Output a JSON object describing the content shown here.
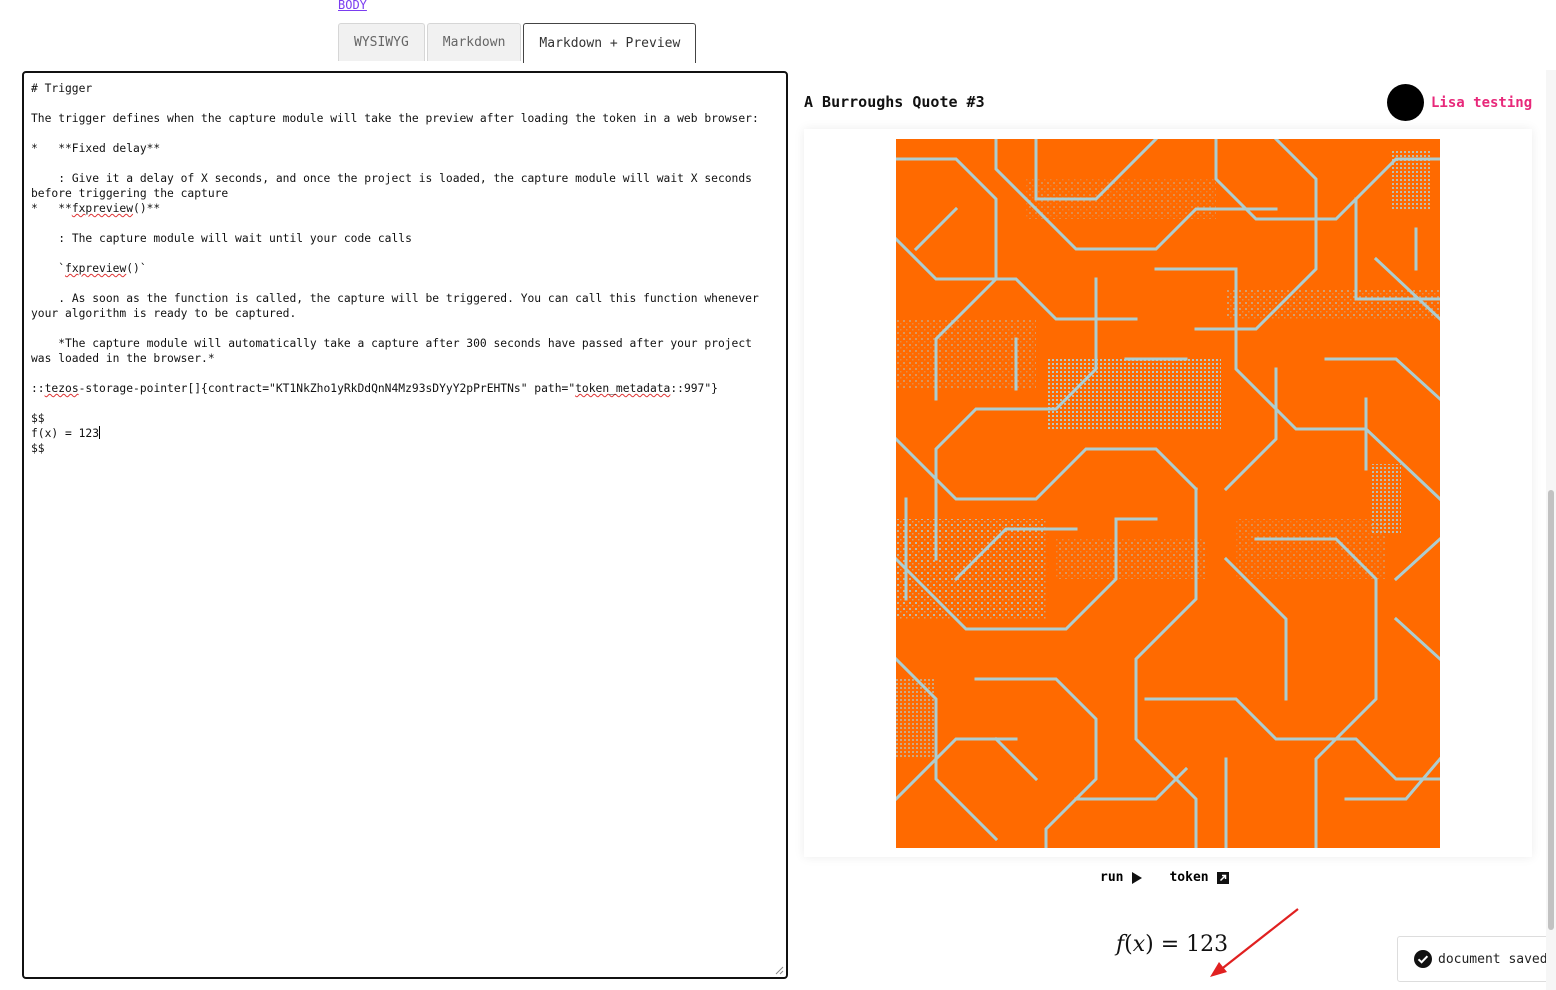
{
  "header": {
    "section_link": "BODY"
  },
  "tabs": [
    {
      "label": "WYSIWYG",
      "active": false
    },
    {
      "label": "Markdown",
      "active": false
    },
    {
      "label": "Markdown + Preview",
      "active": true
    }
  ],
  "editor": {
    "lines": {
      "l1": "# Trigger",
      "l2": "The trigger defines when the capture module will take the preview after loading the token in a web browser:",
      "l3a": "*   **Fixed delay**",
      "l4": "    : Give it a delay of X seconds, and once the project is loaded, the capture module will wait X seconds before triggering the capture",
      "l5_pre": "*   **",
      "l5_sq": "fxpreview",
      "l5_post": "()**",
      "l6": "    : The capture module will wait until your code calls",
      "l7_pre": "    `",
      "l7_sq": "fxpreview",
      "l7_post": "()`",
      "l8": "    . As soon as the function is called, the capture will be triggered. You can call this function whenever your algorithm is ready to be captured.",
      "l9": "    *The capture module will automatically take a capture after 300 seconds have passed after your project was loaded in the browser.*",
      "l10_pre": "::",
      "l10_sq1": "tezos",
      "l10_mid": "-storage-pointer[]{contract=\"KT1NkZho1yRkDdQnN4Mz93sDYyY2pPrEHTNs\" path=\"",
      "l10_sq2": "token_metadata",
      "l10_post": "::997\"}",
      "l11": "$$",
      "l12": "f(x) = 123",
      "l13": "$$"
    }
  },
  "preview": {
    "title": "A Burroughs Quote #3",
    "author": "Lisa testing",
    "run_label": "run",
    "token_label": "token",
    "math": {
      "lhs_f": "f",
      "lhs_x": "x",
      "rhs": "= 123"
    }
  },
  "toast": {
    "message": "document saved"
  },
  "colors": {
    "art_bg": "#ff6a00",
    "art_lines": "#a9d3dc",
    "author": "#e8287a",
    "link": "#7a3cf0"
  }
}
